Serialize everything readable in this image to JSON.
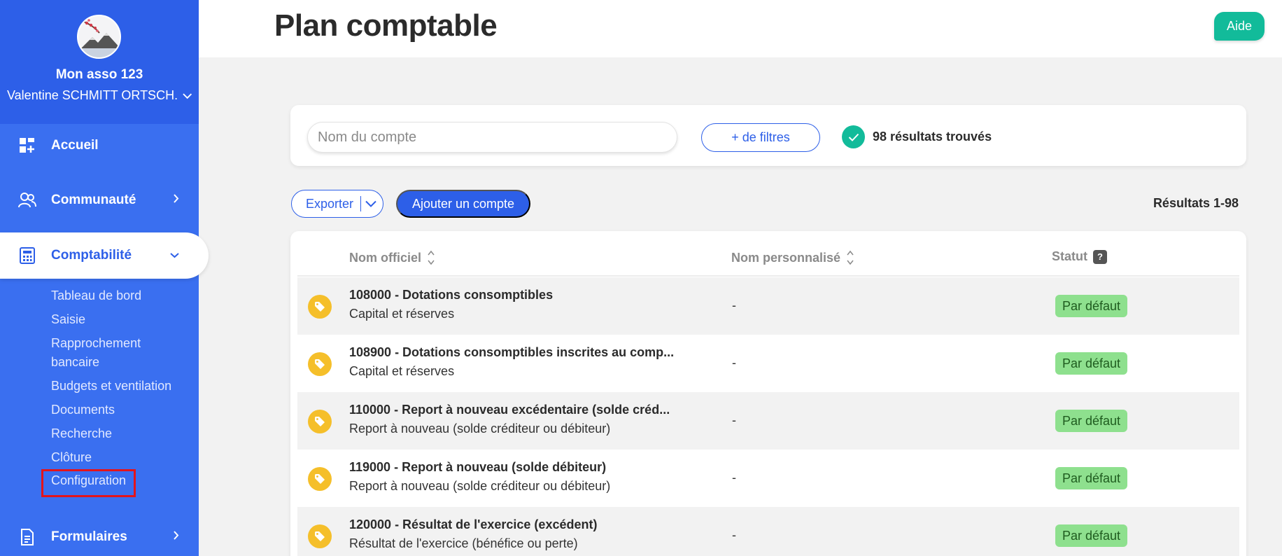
{
  "sidebar": {
    "org_name": "Mon asso 123",
    "user_name": "Valentine SCHMITT ORTSCH...",
    "nav": {
      "home": "Accueil",
      "community": "Communauté",
      "accounting": "Comptabilité",
      "forms": "Formulaires"
    },
    "sub_items": [
      "Tableau de bord",
      "Saisie",
      "Rapprochement",
      "bancaire",
      "Budgets et ventilation",
      "Documents",
      "Recherche",
      "Clôture",
      "Configuration"
    ]
  },
  "header": {
    "title": "Plan comptable",
    "help_label": "Aide"
  },
  "search": {
    "placeholder": "Nom du compte",
    "filters_label": "+ de filtres",
    "results_found": "98 résultats trouvés"
  },
  "toolbar": {
    "export_label": "Exporter",
    "add_label": "Ajouter un compte",
    "range": "Résultats 1-98"
  },
  "table": {
    "columns": [
      "Nom officiel",
      "Nom personnalisé",
      "Statut"
    ],
    "help_mark": "?",
    "rows": [
      {
        "title": "108000 - Dotations consomptibles",
        "subtitle": "Capital et réserves",
        "custom": "-",
        "status": "Par défaut"
      },
      {
        "title": "108900 - Dotations consomptibles inscrites au comp...",
        "subtitle": "Capital et réserves",
        "custom": "-",
        "status": "Par défaut"
      },
      {
        "title": "110000 - Report à nouveau excédentaire (solde créd...",
        "subtitle": "Report à nouveau (solde créditeur ou débiteur)",
        "custom": "-",
        "status": "Par défaut"
      },
      {
        "title": "119000 - Report à nouveau (solde débiteur)",
        "subtitle": "Report à nouveau (solde créditeur ou débiteur)",
        "custom": "-",
        "status": "Par défaut"
      },
      {
        "title": "120000 - Résultat de l'exercice (excédent)",
        "subtitle": "Résultat de l'exercice (bénéfice ou perte)",
        "custom": "-",
        "status": "Par défaut"
      }
    ]
  },
  "colors": {
    "primary": "#2d5fe8",
    "sidebar": "#3a6ff0",
    "success": "#12bb9a",
    "tag": "#f5bf2a",
    "status_bg": "#8ee08e",
    "highlight": "#e3141b"
  }
}
